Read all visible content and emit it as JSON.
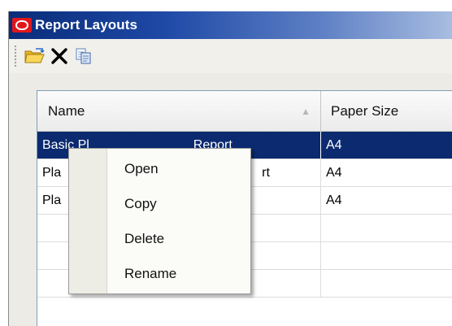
{
  "window": {
    "title": "Report Layouts"
  },
  "toolbar": {
    "buttons": [
      {
        "name": "open-folder",
        "icon": "folder-open-icon"
      },
      {
        "name": "delete",
        "icon": "close-x-icon"
      },
      {
        "name": "copy",
        "icon": "copy-icon"
      }
    ]
  },
  "grid": {
    "columns": [
      "Name",
      "Paper Size"
    ],
    "sort_indicator": "▲",
    "rows": [
      {
        "name": "Basic Pl",
        "name_tail": "Report",
        "paper": "A4",
        "selected": true
      },
      {
        "name": "Pla",
        "name_tail": "rt",
        "paper": "A4",
        "selected": false
      },
      {
        "name": "Pla",
        "name_tail": "",
        "paper": "A4",
        "selected": false
      },
      {
        "name": "",
        "name_tail": "",
        "paper": "",
        "selected": false
      },
      {
        "name": "",
        "name_tail": "",
        "paper": "",
        "selected": false
      },
      {
        "name": "",
        "name_tail": "",
        "paper": "",
        "selected": false
      }
    ]
  },
  "context_menu": {
    "items": [
      "Open",
      "Copy",
      "Delete",
      "Rename"
    ]
  },
  "colors": {
    "title_start": "#0a2c79",
    "selection": "#0b2a6f",
    "logo_red": "#e2161b"
  }
}
